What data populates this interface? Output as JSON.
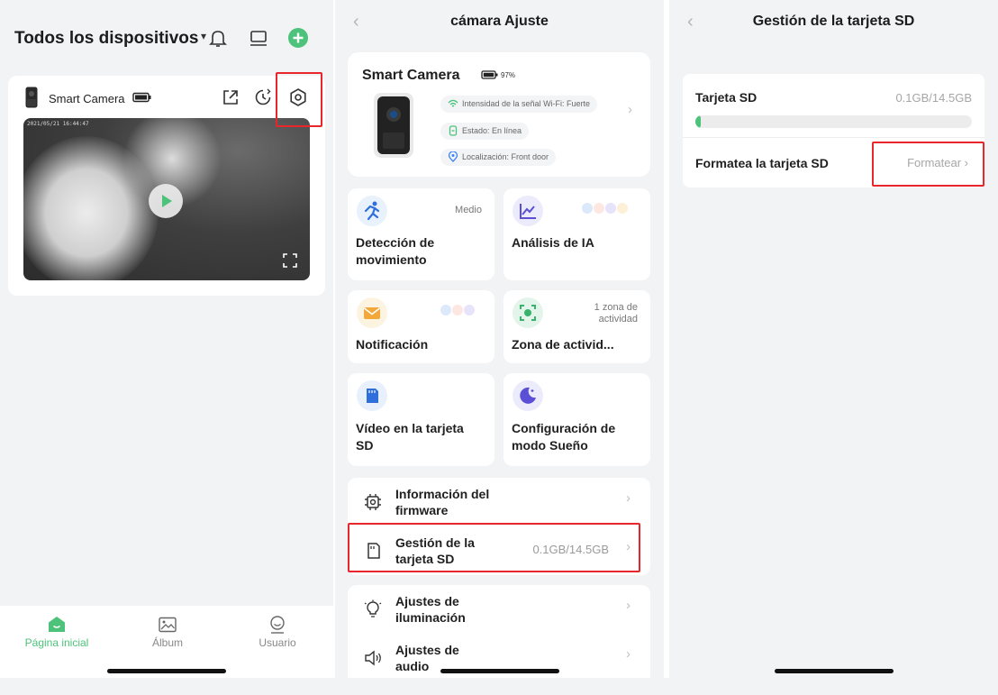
{
  "panel1": {
    "header": {
      "title": "Todos los dispositivos",
      "caret": "▾",
      "icons": [
        "bell-icon",
        "monitor-icon",
        "add-circle-icon"
      ]
    },
    "camera_card": {
      "name": "Smart Camera",
      "timestamp": "2021/05/21 16:44:47",
      "icons": [
        "share-icon",
        "history-icon",
        "settings-icon",
        "play-icon",
        "fullscreen-icon"
      ]
    },
    "tabs": [
      {
        "label": "Página inicial",
        "icon": "home-icon",
        "active": true
      },
      {
        "label": "Álbum",
        "icon": "album-icon",
        "active": false
      },
      {
        "label": "Usuario",
        "icon": "user-icon",
        "active": false
      }
    ]
  },
  "panel2": {
    "title": "cámara Ajuste",
    "device": {
      "name": "Smart Camera",
      "battery": "97%",
      "wifi": "Intensidad de la señal Wi-Fi: Fuerte",
      "status": "Estado: En línea",
      "location": "Localización: Front door"
    },
    "features": [
      {
        "name": "Detección de movimiento",
        "value": "Medio",
        "icon": "running-icon"
      },
      {
        "name": "Análisis de IA",
        "value": "",
        "icon": "chart-icon"
      },
      {
        "name": "Notificación",
        "value": "",
        "icon": "envelope-icon"
      },
      {
        "name": "Zona de activid...",
        "value": "1 zona de actividad",
        "icon": "zone-icon"
      },
      {
        "name": "Vídeo en la tarjeta SD",
        "value": "",
        "icon": "sd-card-icon"
      },
      {
        "name": "Configuración de modo Sueño",
        "value": "",
        "icon": "moon-icon"
      }
    ],
    "list1": [
      {
        "label": "Información del firmware",
        "value": "",
        "icon": "chip-icon"
      },
      {
        "label": "Gestión de la tarjeta SD",
        "value": "0.1GB/14.5GB",
        "icon": "sd-icon"
      }
    ],
    "list2": [
      {
        "label": "Ajustes de iluminación",
        "value": "",
        "icon": "bulb-icon"
      },
      {
        "label": "Ajustes de audio",
        "value": "",
        "icon": "speaker-icon"
      }
    ]
  },
  "panel3": {
    "title": "Gestión de la tarjeta SD",
    "sd_label": "Tarjeta SD",
    "sd_value": "0.1GB/14.5GB",
    "sd_used_fraction": 0.007,
    "format_label": "Formatea la tarjeta SD",
    "format_button": "Formatear"
  },
  "colors": {
    "accent": "#4cc27a",
    "highlight": "#e8262b",
    "background": "#f2f3f5"
  }
}
